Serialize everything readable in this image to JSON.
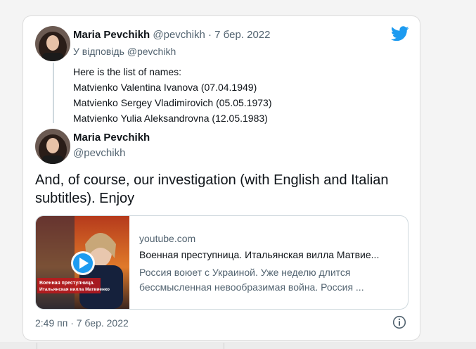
{
  "tweet_reply": {
    "author_name": "Maria Pevchikh",
    "author_handle": "@pevchikh",
    "separator": " · ",
    "date": "7 бер. 2022",
    "reply_to": "У відповідь @pevchikh",
    "lines": [
      "Here is the list of names:",
      "Matvienko Valentina Ivanova (07.04.1949)",
      "Matvienko Sergey Vladimirovich (05.05.1973)",
      "Matvienko Yulia Aleksandrovna (12.05.1983)"
    ]
  },
  "tweet_main": {
    "author_name": "Maria Pevchikh",
    "author_handle": "@pevchikh",
    "text": "And, of course, our investigation (with English and Italian subtitles). Enjoy",
    "link_card": {
      "domain": "youtube.com",
      "title": "Военная преступница. Итальянская вилла Матвие...",
      "description": "Россия воюет с Украиной. Уже неделю длится бессмысленная невообразимая война. Россия ...",
      "thumbnail_caption_line1": "Военная преступница.",
      "thumbnail_caption_line2": "Итальянская вилла Матвиенко"
    },
    "timestamp": "2:49 пп · 7 бер. 2022"
  },
  "icons": {
    "brand": "twitter-bird-icon",
    "play": "play-icon",
    "info": "info-icon"
  },
  "colors": {
    "twitter_blue": "#1d9bf0",
    "muted_text": "#536471",
    "border": "#cfd9de"
  }
}
